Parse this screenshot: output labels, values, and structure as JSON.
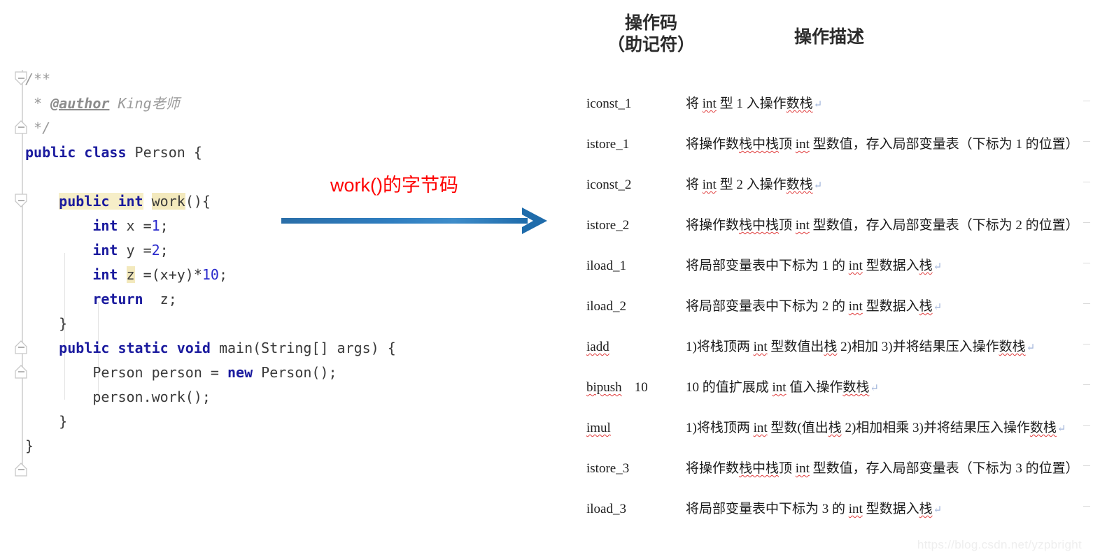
{
  "editor": {
    "language": "java",
    "fold_markers": [
      "collapse-down",
      "collapse-up",
      "collapse-down",
      "collapse-up",
      "collapse-down",
      "collapse-up"
    ],
    "lines": [
      {
        "indent": 0,
        "tokens": [
          {
            "t": "/**",
            "style": "comment"
          }
        ]
      },
      {
        "indent": 0,
        "tokens": [
          {
            "t": " * ",
            "style": "comment"
          },
          {
            "t": "@author",
            "style": "javadoc-tag"
          },
          {
            "t": " King老师",
            "style": "comment"
          }
        ]
      },
      {
        "indent": 0,
        "tokens": [
          {
            "t": " */",
            "style": "comment"
          }
        ]
      },
      {
        "indent": 0,
        "tokens": [
          {
            "t": "public class",
            "style": "keyword"
          },
          {
            "t": " Person {",
            "style": "plain"
          }
        ]
      },
      {
        "indent": 0,
        "tokens": []
      },
      {
        "indent": 1,
        "tokens": [
          {
            "t": "public int",
            "style": "keyword-highlight"
          },
          {
            "t": " ",
            "style": "plain"
          },
          {
            "t": "work",
            "style": "plain-highlight"
          },
          {
            "t": "(){",
            "style": "plain"
          }
        ]
      },
      {
        "indent": 2,
        "tokens": [
          {
            "t": "int",
            "style": "keyword"
          },
          {
            "t": " x =",
            "style": "plain"
          },
          {
            "t": "1",
            "style": "number"
          },
          {
            "t": ";",
            "style": "plain"
          }
        ]
      },
      {
        "indent": 2,
        "tokens": [
          {
            "t": "int",
            "style": "keyword"
          },
          {
            "t": " y =",
            "style": "plain"
          },
          {
            "t": "2",
            "style": "number"
          },
          {
            "t": ";",
            "style": "plain"
          }
        ]
      },
      {
        "indent": 2,
        "tokens": [
          {
            "t": "int",
            "style": "keyword"
          },
          {
            "t": " ",
            "style": "plain"
          },
          {
            "t": "z",
            "style": "plain-highlight"
          },
          {
            "t": " =(x+y)*",
            "style": "plain"
          },
          {
            "t": "10",
            "style": "number"
          },
          {
            "t": ";",
            "style": "plain"
          }
        ]
      },
      {
        "indent": 2,
        "tokens": [
          {
            "t": "return",
            "style": "keyword"
          },
          {
            "t": "  z;",
            "style": "plain"
          }
        ]
      },
      {
        "indent": 1,
        "tokens": [
          {
            "t": "}",
            "style": "plain"
          }
        ]
      },
      {
        "indent": 1,
        "tokens": [
          {
            "t": "public static void",
            "style": "keyword"
          },
          {
            "t": " main(String[] args) {",
            "style": "plain"
          }
        ]
      },
      {
        "indent": 2,
        "tokens": [
          {
            "t": "Person person = ",
            "style": "plain"
          },
          {
            "t": "new",
            "style": "keyword"
          },
          {
            "t": " Person();",
            "style": "plain"
          }
        ]
      },
      {
        "indent": 2,
        "tokens": [
          {
            "t": "person.work();",
            "style": "plain"
          }
        ]
      },
      {
        "indent": 1,
        "tokens": [
          {
            "t": "}",
            "style": "plain"
          }
        ]
      },
      {
        "indent": 0,
        "tokens": [
          {
            "t": "}",
            "style": "plain"
          }
        ]
      }
    ]
  },
  "annotation": {
    "label": "work()的字节码",
    "label_color": "#fe0000",
    "arrow_color": "#1f6cab",
    "arrow_direction": "right"
  },
  "opcode_table": {
    "headers": {
      "opcode": "操作码\n（助记符）",
      "description": "操作描述"
    },
    "rows": [
      {
        "opcode": "iconst_1",
        "operand": "",
        "opcode_misspelled": false,
        "desc_parts": [
          {
            "t": "将 "
          },
          {
            "t": "int",
            "squiggly": true
          },
          {
            "t": " 型 1 入操作"
          },
          {
            "t": "数栈",
            "squiggly": true
          }
        ],
        "pilcrow": true
      },
      {
        "opcode": "istore_1",
        "operand": "",
        "opcode_misspelled": false,
        "desc_parts": [
          {
            "t": "将操作数"
          },
          {
            "t": "栈中栈",
            "squiggly": true
          },
          {
            "t": "顶 "
          },
          {
            "t": "int",
            "squiggly": true
          },
          {
            "t": " 型数值，存入局部变量表（下标为 1 的位置）"
          }
        ],
        "pilcrow": false
      },
      {
        "opcode": "iconst_2",
        "operand": "",
        "opcode_misspelled": false,
        "desc_parts": [
          {
            "t": "将 "
          },
          {
            "t": "int",
            "squiggly": true
          },
          {
            "t": " 型 2 入操作"
          },
          {
            "t": "数栈",
            "squiggly": true
          }
        ],
        "pilcrow": true
      },
      {
        "opcode": "istore_2",
        "operand": "",
        "opcode_misspelled": false,
        "desc_parts": [
          {
            "t": "将操作数"
          },
          {
            "t": "栈中栈",
            "squiggly": true
          },
          {
            "t": "顶 "
          },
          {
            "t": "int",
            "squiggly": true
          },
          {
            "t": " 型数值，存入局部变量表（下标为 2 的位置）"
          }
        ],
        "pilcrow": false
      },
      {
        "opcode": "iload_1",
        "operand": "",
        "opcode_misspelled": false,
        "desc_parts": [
          {
            "t": "将局部变量表中下标为 1 的 "
          },
          {
            "t": "int",
            "squiggly": true
          },
          {
            "t": " 型数据入"
          },
          {
            "t": "栈",
            "squiggly": true
          }
        ],
        "pilcrow": true
      },
      {
        "opcode": "iload_2",
        "operand": "",
        "opcode_misspelled": false,
        "desc_parts": [
          {
            "t": "将局部变量表中下标为 2 的 "
          },
          {
            "t": "int",
            "squiggly": true
          },
          {
            "t": " 型数据入"
          },
          {
            "t": "栈",
            "squiggly": true
          }
        ],
        "pilcrow": true
      },
      {
        "opcode": "iadd",
        "operand": "",
        "opcode_misspelled": true,
        "desc_parts": [
          {
            "t": "1)将栈顶两 "
          },
          {
            "t": "int",
            "squiggly": true
          },
          {
            "t": " 型数值出"
          },
          {
            "t": "栈",
            "squiggly": true
          },
          {
            "t": "  2)相加  3)并将结果压入操作"
          },
          {
            "t": "数栈",
            "squiggly": true
          }
        ],
        "pilcrow": true
      },
      {
        "opcode": "bipush",
        "operand": "10",
        "opcode_misspelled": true,
        "desc_parts": [
          {
            "t": "10 的值扩展成 "
          },
          {
            "t": "int",
            "squiggly": true
          },
          {
            "t": " 值入操作"
          },
          {
            "t": "数栈",
            "squiggly": true
          }
        ],
        "pilcrow": true
      },
      {
        "opcode": "imul",
        "operand": "",
        "opcode_misspelled": true,
        "desc_parts": [
          {
            "t": "1)将栈顶两 "
          },
          {
            "t": "int",
            "squiggly": true
          },
          {
            "t": " 型数(值出"
          },
          {
            "t": "栈",
            "squiggly": true
          },
          {
            "t": "  2)相加相乘 3)并将结果压入操作"
          },
          {
            "t": "数栈",
            "squiggly": true
          }
        ],
        "pilcrow": true
      },
      {
        "opcode": "istore_3",
        "operand": "",
        "opcode_misspelled": false,
        "desc_parts": [
          {
            "t": "将操作数"
          },
          {
            "t": "栈中栈",
            "squiggly": true
          },
          {
            "t": "顶 "
          },
          {
            "t": "int",
            "squiggly": true
          },
          {
            "t": " 型数值，存入局部变量表（下标为 3 的位置）"
          }
        ],
        "pilcrow": false
      },
      {
        "opcode": "iload_3",
        "operand": "",
        "opcode_misspelled": false,
        "desc_parts": [
          {
            "t": "将局部变量表中下标为 3 的 "
          },
          {
            "t": "int",
            "squiggly": true
          },
          {
            "t": " 型数据入"
          },
          {
            "t": "栈",
            "squiggly": true
          }
        ],
        "pilcrow": true
      }
    ]
  },
  "watermark": "https://blog.csdn.net/yzpbright"
}
